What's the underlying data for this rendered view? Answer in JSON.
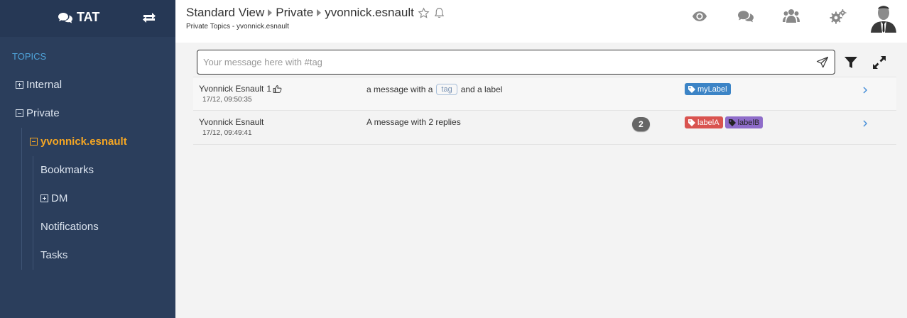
{
  "sidebar": {
    "brand": "TAT",
    "section": "TOPICS",
    "items": [
      {
        "label": "Internal"
      },
      {
        "label": "Private"
      },
      {
        "label": "yvonnick.esnault"
      },
      {
        "label": "Bookmarks"
      },
      {
        "label": "DM"
      },
      {
        "label": "Notifications"
      },
      {
        "label": "Tasks"
      }
    ]
  },
  "header": {
    "crumbs": [
      "Standard View",
      "Private",
      "yvonnick.esnault"
    ],
    "subtitle": "Private Topics - yvonnick.esnault",
    "icons": [
      "eye-icon",
      "comments-icon",
      "users-icon",
      "gears-icon",
      "avatar"
    ]
  },
  "composer": {
    "placeholder": "Your message here with #tag",
    "value": ""
  },
  "messages": [
    {
      "author": "Yvonnick Esnault",
      "likes": "1",
      "date": "17/12, 09:50:35",
      "text_before": "a message with a",
      "tag": "tag",
      "text_after": "and a label",
      "labels": [
        {
          "text": "myLabel",
          "color": "#3c84c6"
        }
      ]
    },
    {
      "author": "Yvonnick Esnault",
      "date": "17/12, 09:49:41",
      "text": "A message with 2 replies",
      "replies": "2",
      "labels": [
        {
          "text": "labelA",
          "color": "#d9534f"
        },
        {
          "text": "labelB",
          "color": "#8e6cc9"
        }
      ]
    }
  ],
  "colors": {
    "sidebar_bg": "#2b3e5c",
    "active": "#f5a623",
    "section": "#4fa3d9"
  }
}
